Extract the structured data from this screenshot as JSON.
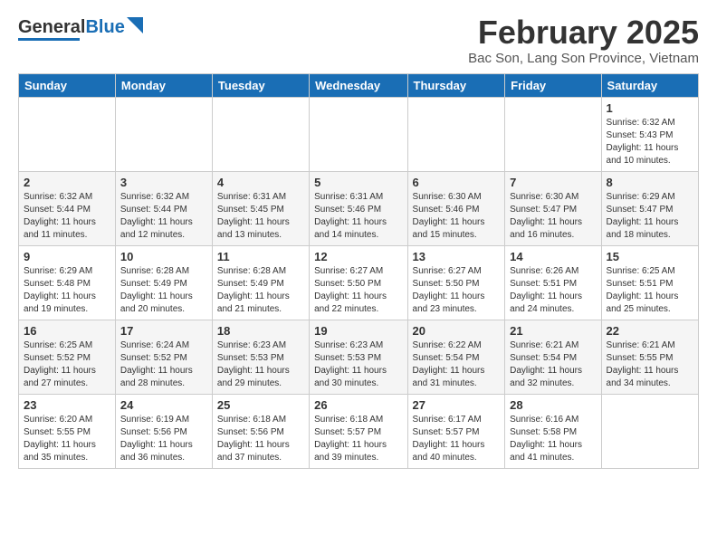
{
  "header": {
    "logo_text_general": "General",
    "logo_text_blue": "Blue",
    "title": "February 2025",
    "subtitle": "Bac Son, Lang Son Province, Vietnam"
  },
  "calendar": {
    "days_of_week": [
      "Sunday",
      "Monday",
      "Tuesday",
      "Wednesday",
      "Thursday",
      "Friday",
      "Saturday"
    ],
    "weeks": [
      [
        {
          "day": "",
          "info": ""
        },
        {
          "day": "",
          "info": ""
        },
        {
          "day": "",
          "info": ""
        },
        {
          "day": "",
          "info": ""
        },
        {
          "day": "",
          "info": ""
        },
        {
          "day": "",
          "info": ""
        },
        {
          "day": "1",
          "info": "Sunrise: 6:32 AM\nSunset: 5:43 PM\nDaylight: 11 hours and 10 minutes."
        }
      ],
      [
        {
          "day": "2",
          "info": "Sunrise: 6:32 AM\nSunset: 5:44 PM\nDaylight: 11 hours and 11 minutes."
        },
        {
          "day": "3",
          "info": "Sunrise: 6:32 AM\nSunset: 5:44 PM\nDaylight: 11 hours and 12 minutes."
        },
        {
          "day": "4",
          "info": "Sunrise: 6:31 AM\nSunset: 5:45 PM\nDaylight: 11 hours and 13 minutes."
        },
        {
          "day": "5",
          "info": "Sunrise: 6:31 AM\nSunset: 5:46 PM\nDaylight: 11 hours and 14 minutes."
        },
        {
          "day": "6",
          "info": "Sunrise: 6:30 AM\nSunset: 5:46 PM\nDaylight: 11 hours and 15 minutes."
        },
        {
          "day": "7",
          "info": "Sunrise: 6:30 AM\nSunset: 5:47 PM\nDaylight: 11 hours and 16 minutes."
        },
        {
          "day": "8",
          "info": "Sunrise: 6:29 AM\nSunset: 5:47 PM\nDaylight: 11 hours and 18 minutes."
        }
      ],
      [
        {
          "day": "9",
          "info": "Sunrise: 6:29 AM\nSunset: 5:48 PM\nDaylight: 11 hours and 19 minutes."
        },
        {
          "day": "10",
          "info": "Sunrise: 6:28 AM\nSunset: 5:49 PM\nDaylight: 11 hours and 20 minutes."
        },
        {
          "day": "11",
          "info": "Sunrise: 6:28 AM\nSunset: 5:49 PM\nDaylight: 11 hours and 21 minutes."
        },
        {
          "day": "12",
          "info": "Sunrise: 6:27 AM\nSunset: 5:50 PM\nDaylight: 11 hours and 22 minutes."
        },
        {
          "day": "13",
          "info": "Sunrise: 6:27 AM\nSunset: 5:50 PM\nDaylight: 11 hours and 23 minutes."
        },
        {
          "day": "14",
          "info": "Sunrise: 6:26 AM\nSunset: 5:51 PM\nDaylight: 11 hours and 24 minutes."
        },
        {
          "day": "15",
          "info": "Sunrise: 6:25 AM\nSunset: 5:51 PM\nDaylight: 11 hours and 25 minutes."
        }
      ],
      [
        {
          "day": "16",
          "info": "Sunrise: 6:25 AM\nSunset: 5:52 PM\nDaylight: 11 hours and 27 minutes."
        },
        {
          "day": "17",
          "info": "Sunrise: 6:24 AM\nSunset: 5:52 PM\nDaylight: 11 hours and 28 minutes."
        },
        {
          "day": "18",
          "info": "Sunrise: 6:23 AM\nSunset: 5:53 PM\nDaylight: 11 hours and 29 minutes."
        },
        {
          "day": "19",
          "info": "Sunrise: 6:23 AM\nSunset: 5:53 PM\nDaylight: 11 hours and 30 minutes."
        },
        {
          "day": "20",
          "info": "Sunrise: 6:22 AM\nSunset: 5:54 PM\nDaylight: 11 hours and 31 minutes."
        },
        {
          "day": "21",
          "info": "Sunrise: 6:21 AM\nSunset: 5:54 PM\nDaylight: 11 hours and 32 minutes."
        },
        {
          "day": "22",
          "info": "Sunrise: 6:21 AM\nSunset: 5:55 PM\nDaylight: 11 hours and 34 minutes."
        }
      ],
      [
        {
          "day": "23",
          "info": "Sunrise: 6:20 AM\nSunset: 5:55 PM\nDaylight: 11 hours and 35 minutes."
        },
        {
          "day": "24",
          "info": "Sunrise: 6:19 AM\nSunset: 5:56 PM\nDaylight: 11 hours and 36 minutes."
        },
        {
          "day": "25",
          "info": "Sunrise: 6:18 AM\nSunset: 5:56 PM\nDaylight: 11 hours and 37 minutes."
        },
        {
          "day": "26",
          "info": "Sunrise: 6:18 AM\nSunset: 5:57 PM\nDaylight: 11 hours and 39 minutes."
        },
        {
          "day": "27",
          "info": "Sunrise: 6:17 AM\nSunset: 5:57 PM\nDaylight: 11 hours and 40 minutes."
        },
        {
          "day": "28",
          "info": "Sunrise: 6:16 AM\nSunset: 5:58 PM\nDaylight: 11 hours and 41 minutes."
        },
        {
          "day": "",
          "info": ""
        }
      ]
    ]
  }
}
